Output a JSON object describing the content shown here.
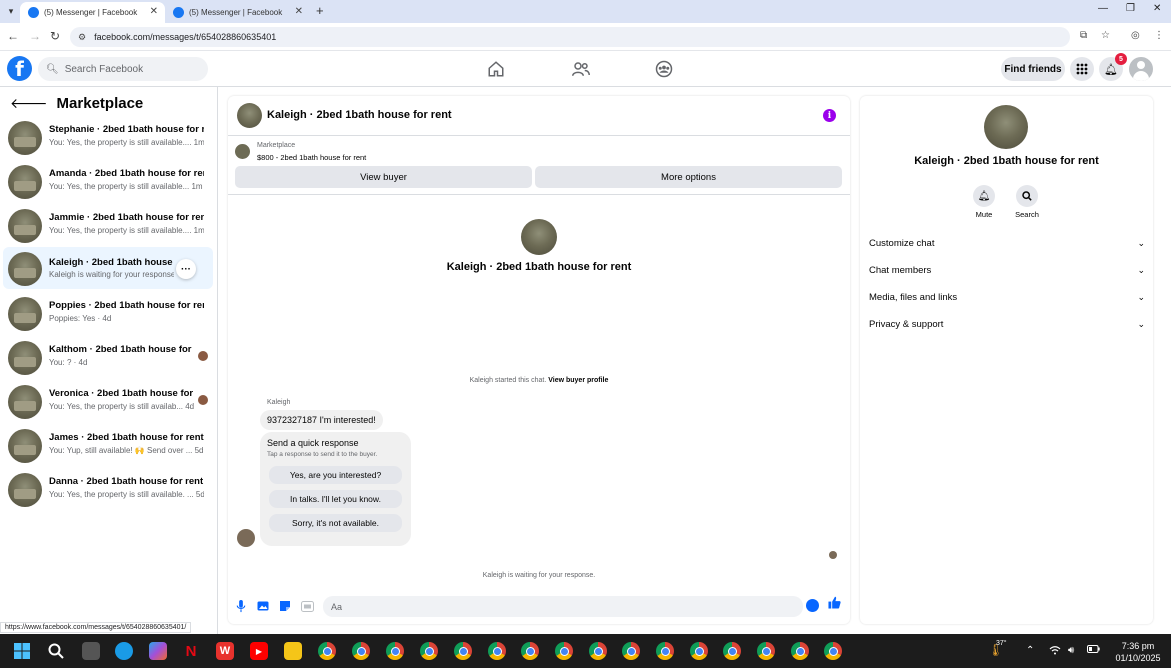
{
  "browser": {
    "tabs": [
      {
        "label": "(5) Messenger | Facebook",
        "active": true
      },
      {
        "label": "(5) Messenger | Facebook",
        "active": false
      }
    ],
    "url": "facebook.com/messages/t/654028860635401",
    "status_url": "https://www.facebook.com/messages/t/654028860635401/"
  },
  "fb_header": {
    "search_placeholder": "Search Facebook",
    "find_friends": "Find friends",
    "notification_count": "5"
  },
  "sidebar": {
    "title": "Marketplace",
    "conversations": [
      {
        "title": "Stephanie · 2bed 1bath house for r...",
        "preview": "You: Yes, the property is still available.... 1m"
      },
      {
        "title": "Amanda · 2bed 1bath house for rent",
        "preview": "You: Yes, the property is still available... 1m"
      },
      {
        "title": "Jammie · 2bed 1bath house for rent",
        "preview": "You: Yes, the property is still available.... 1m"
      },
      {
        "title": "Kaleigh · 2bed 1bath house for rent",
        "preview": "Kaleigh is waiting for your response.",
        "selected": true
      },
      {
        "title": "Poppies · 2bed 1bath house for rent",
        "preview": "Poppies: Yes · 4d"
      },
      {
        "title": "Kalthom · 2bed 1bath house for ...",
        "preview": "You: ? · 4d"
      },
      {
        "title": "Veronica · 2bed 1bath house for ...",
        "preview": "You: Yes, the property is still availab... 4d"
      },
      {
        "title": "James · 2bed 1bath house for rent",
        "preview": "You: Yup, still available! 🙌 Send over ... 5d"
      },
      {
        "title": "Danna · 2bed 1bath house for rent",
        "preview": "You: Yes, the property is still available. ... 5d"
      }
    ],
    "more_label": "···"
  },
  "chat": {
    "header_name": "Kaleigh · 2bed 1bath house for rent",
    "marketplace_label": "Marketplace",
    "listing": "$800 - 2bed 1bath house for rent",
    "view_buyer": "View buyer",
    "more_options": "More options",
    "center_name": "Kaleigh · 2bed 1bath house for rent",
    "started_text": "Kaleigh started this chat.",
    "view_buyer_profile": "View buyer profile",
    "sender": "Kaleigh",
    "message": "9372327187 I'm interested!",
    "quick_title": "Send a quick response",
    "quick_subtitle": "Tap a response to send it to the buyer.",
    "quick_options": [
      "Yes, are you interested?",
      "In talks. I'll let you know.",
      "Sorry, it's not available."
    ],
    "waiting": "Kaleigh is waiting for your response.",
    "input_placeholder": "Aa"
  },
  "right_panel": {
    "name": "Kaleigh · 2bed 1bath house for rent",
    "mute": "Mute",
    "search": "Search",
    "sections": [
      "Customize chat",
      "Chat members",
      "Media, files and links",
      "Privacy & support"
    ]
  },
  "taskbar": {
    "temperature": "37°",
    "time": "7:36 pm",
    "date": "01/10/2025"
  },
  "colors": {
    "fb_blue": "#1877f2",
    "messenger_blue": "#0866ff",
    "selected_bg": "#ebf5ff",
    "badge_red": "#e41e3f",
    "info_purple": "#9b00ec"
  }
}
